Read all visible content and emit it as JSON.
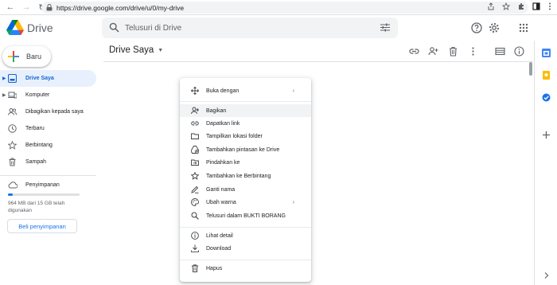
{
  "browser": {
    "url": "https://drive.google.com/drive/u/0/my-drive"
  },
  "app": {
    "name": "Drive",
    "search_placeholder": "Telusuri di Drive",
    "new_label": "Baru"
  },
  "sidebar": {
    "items": [
      {
        "label": "Drive Saya",
        "icon": "my-drive-icon",
        "active": true
      },
      {
        "label": "Komputer",
        "icon": "computer-icon"
      },
      {
        "label": "Dibagikan kepada saya",
        "icon": "shared-icon"
      },
      {
        "label": "Terbaru",
        "icon": "clock-icon"
      },
      {
        "label": "Berbintang",
        "icon": "star-icon"
      },
      {
        "label": "Sampah",
        "icon": "trash-icon"
      }
    ],
    "storage": {
      "label": "Penyimpanan",
      "used_text": "964 MB dari 15 GB telah digunakan",
      "used_fraction": 0.064,
      "buy_label": "Beli penyimpanan"
    }
  },
  "main": {
    "title": "Drive Saya"
  },
  "context_menu": {
    "items": [
      {
        "label": "Buka dengan",
        "icon": "open-with-icon",
        "submenu": true
      },
      {
        "label": "Bagikan",
        "icon": "share-icon",
        "highlighted": true
      },
      {
        "label": "Dapatkan link",
        "icon": "link-icon"
      },
      {
        "label": "Tampilkan lokasi folder",
        "icon": "folder-icon"
      },
      {
        "label": "Tambahkan pintasan ke Drive",
        "icon": "add-shortcut-icon"
      },
      {
        "label": "Pindahkan ke",
        "icon": "move-icon"
      },
      {
        "label": "Tambahkan ke Berbintang",
        "icon": "star-icon"
      },
      {
        "label": "Ganti nama",
        "icon": "rename-icon"
      },
      {
        "label": "Ubah warna",
        "icon": "palette-icon",
        "submenu": true
      },
      {
        "label": "Telusuri dalam BUKTI BORANG",
        "icon": "search-icon"
      },
      {
        "label": "Lihat detail",
        "icon": "info-icon"
      },
      {
        "label": "Download",
        "icon": "download-icon"
      },
      {
        "label": "Hapus",
        "icon": "trash-icon"
      }
    ]
  },
  "colors": {
    "accent": "#1a73e8",
    "active_bg": "#e8f0fe"
  }
}
